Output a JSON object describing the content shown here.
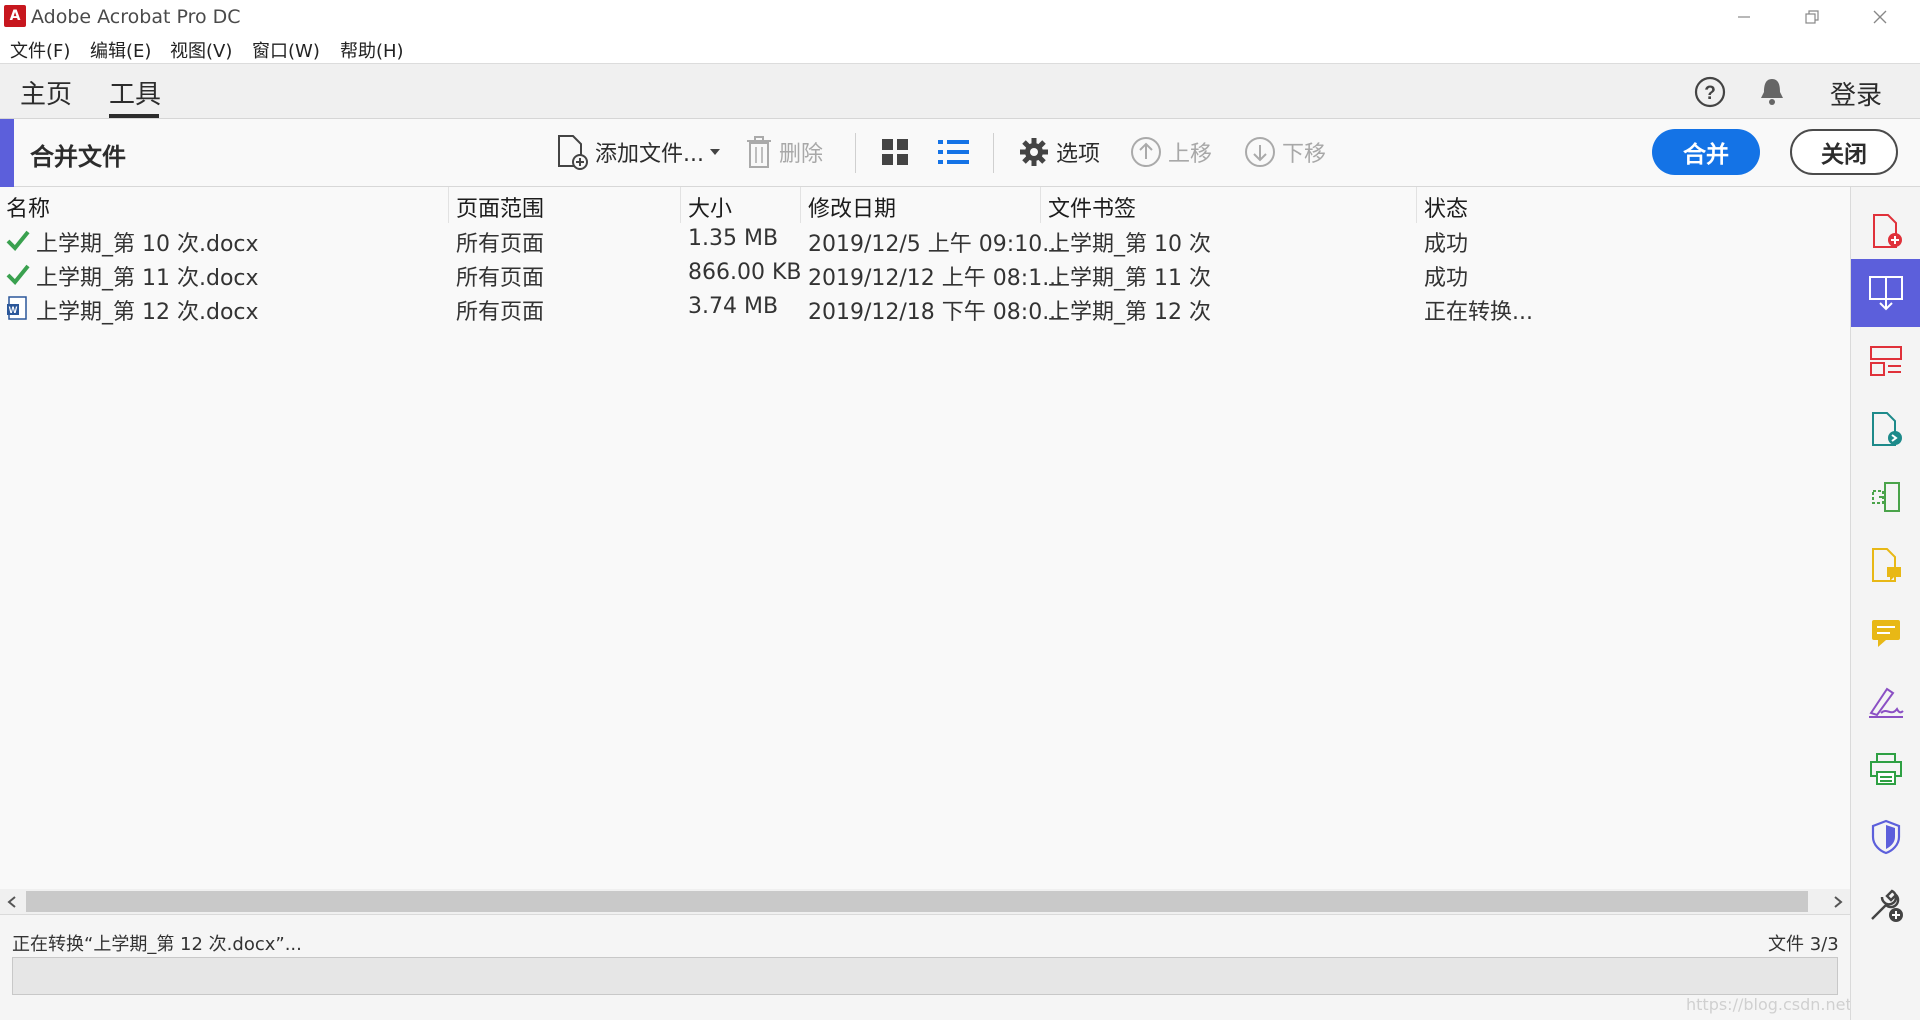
{
  "window": {
    "title": "Adobe Acrobat Pro DC"
  },
  "menu": {
    "items": [
      "文件(F)",
      "编辑(E)",
      "视图(V)",
      "窗口(W)",
      "帮助(H)"
    ]
  },
  "tabs": {
    "home": "主页",
    "tools": "工具",
    "login": "登录"
  },
  "toolbar": {
    "title": "合并文件",
    "add_files": "添加文件...",
    "delete": "删除",
    "options": "选项",
    "move_up": "上移",
    "move_down": "下移",
    "merge": "合并",
    "close": "关闭"
  },
  "table": {
    "headers": [
      "名称",
      "页面范围",
      "大小",
      "修改日期",
      "文件书签",
      "状态"
    ],
    "rows": [
      {
        "icon": "check-icon",
        "name": "上学期_第 10 次.docx",
        "range": "所有页面",
        "size": "1.35 MB",
        "modified": "2019/12/5 上午 09:10...",
        "bookmark": "上学期_第 10 次",
        "status": "成功"
      },
      {
        "icon": "check-icon",
        "name": "上学期_第 11 次.docx",
        "range": "所有页面",
        "size": "866.00 KB",
        "modified": "2019/12/12 上午 08:1...",
        "bookmark": "上学期_第 11 次",
        "status": "成功"
      },
      {
        "icon": "word-doc-icon",
        "name": "上学期_第 12 次.docx",
        "range": "所有页面",
        "size": "3.74 MB",
        "modified": "2019/12/18 下午 08:0...",
        "bookmark": "上学期_第 12 次",
        "status": "正在转换..."
      }
    ]
  },
  "status": {
    "message": "正在转换“上学期_第 12 次.docx”...",
    "file_count": "文件 3/3",
    "watermark": "https://blog.csdn.net/qqmanstng"
  },
  "rail": {
    "tools": [
      "create-pdf-icon",
      "combine-files-icon",
      "organize-pages-icon",
      "export-pdf-icon",
      "edit-pdf-icon",
      "comment-file-icon",
      "comment-icon",
      "fill-sign-icon",
      "print-production-icon",
      "protect-icon",
      "more-tools-icon"
    ],
    "active_index": 1
  },
  "colors": {
    "accent": "#5c5fdb",
    "primary_button": "#1473e6",
    "success": "#3aa14f",
    "acrobat_red": "#c7171e"
  }
}
